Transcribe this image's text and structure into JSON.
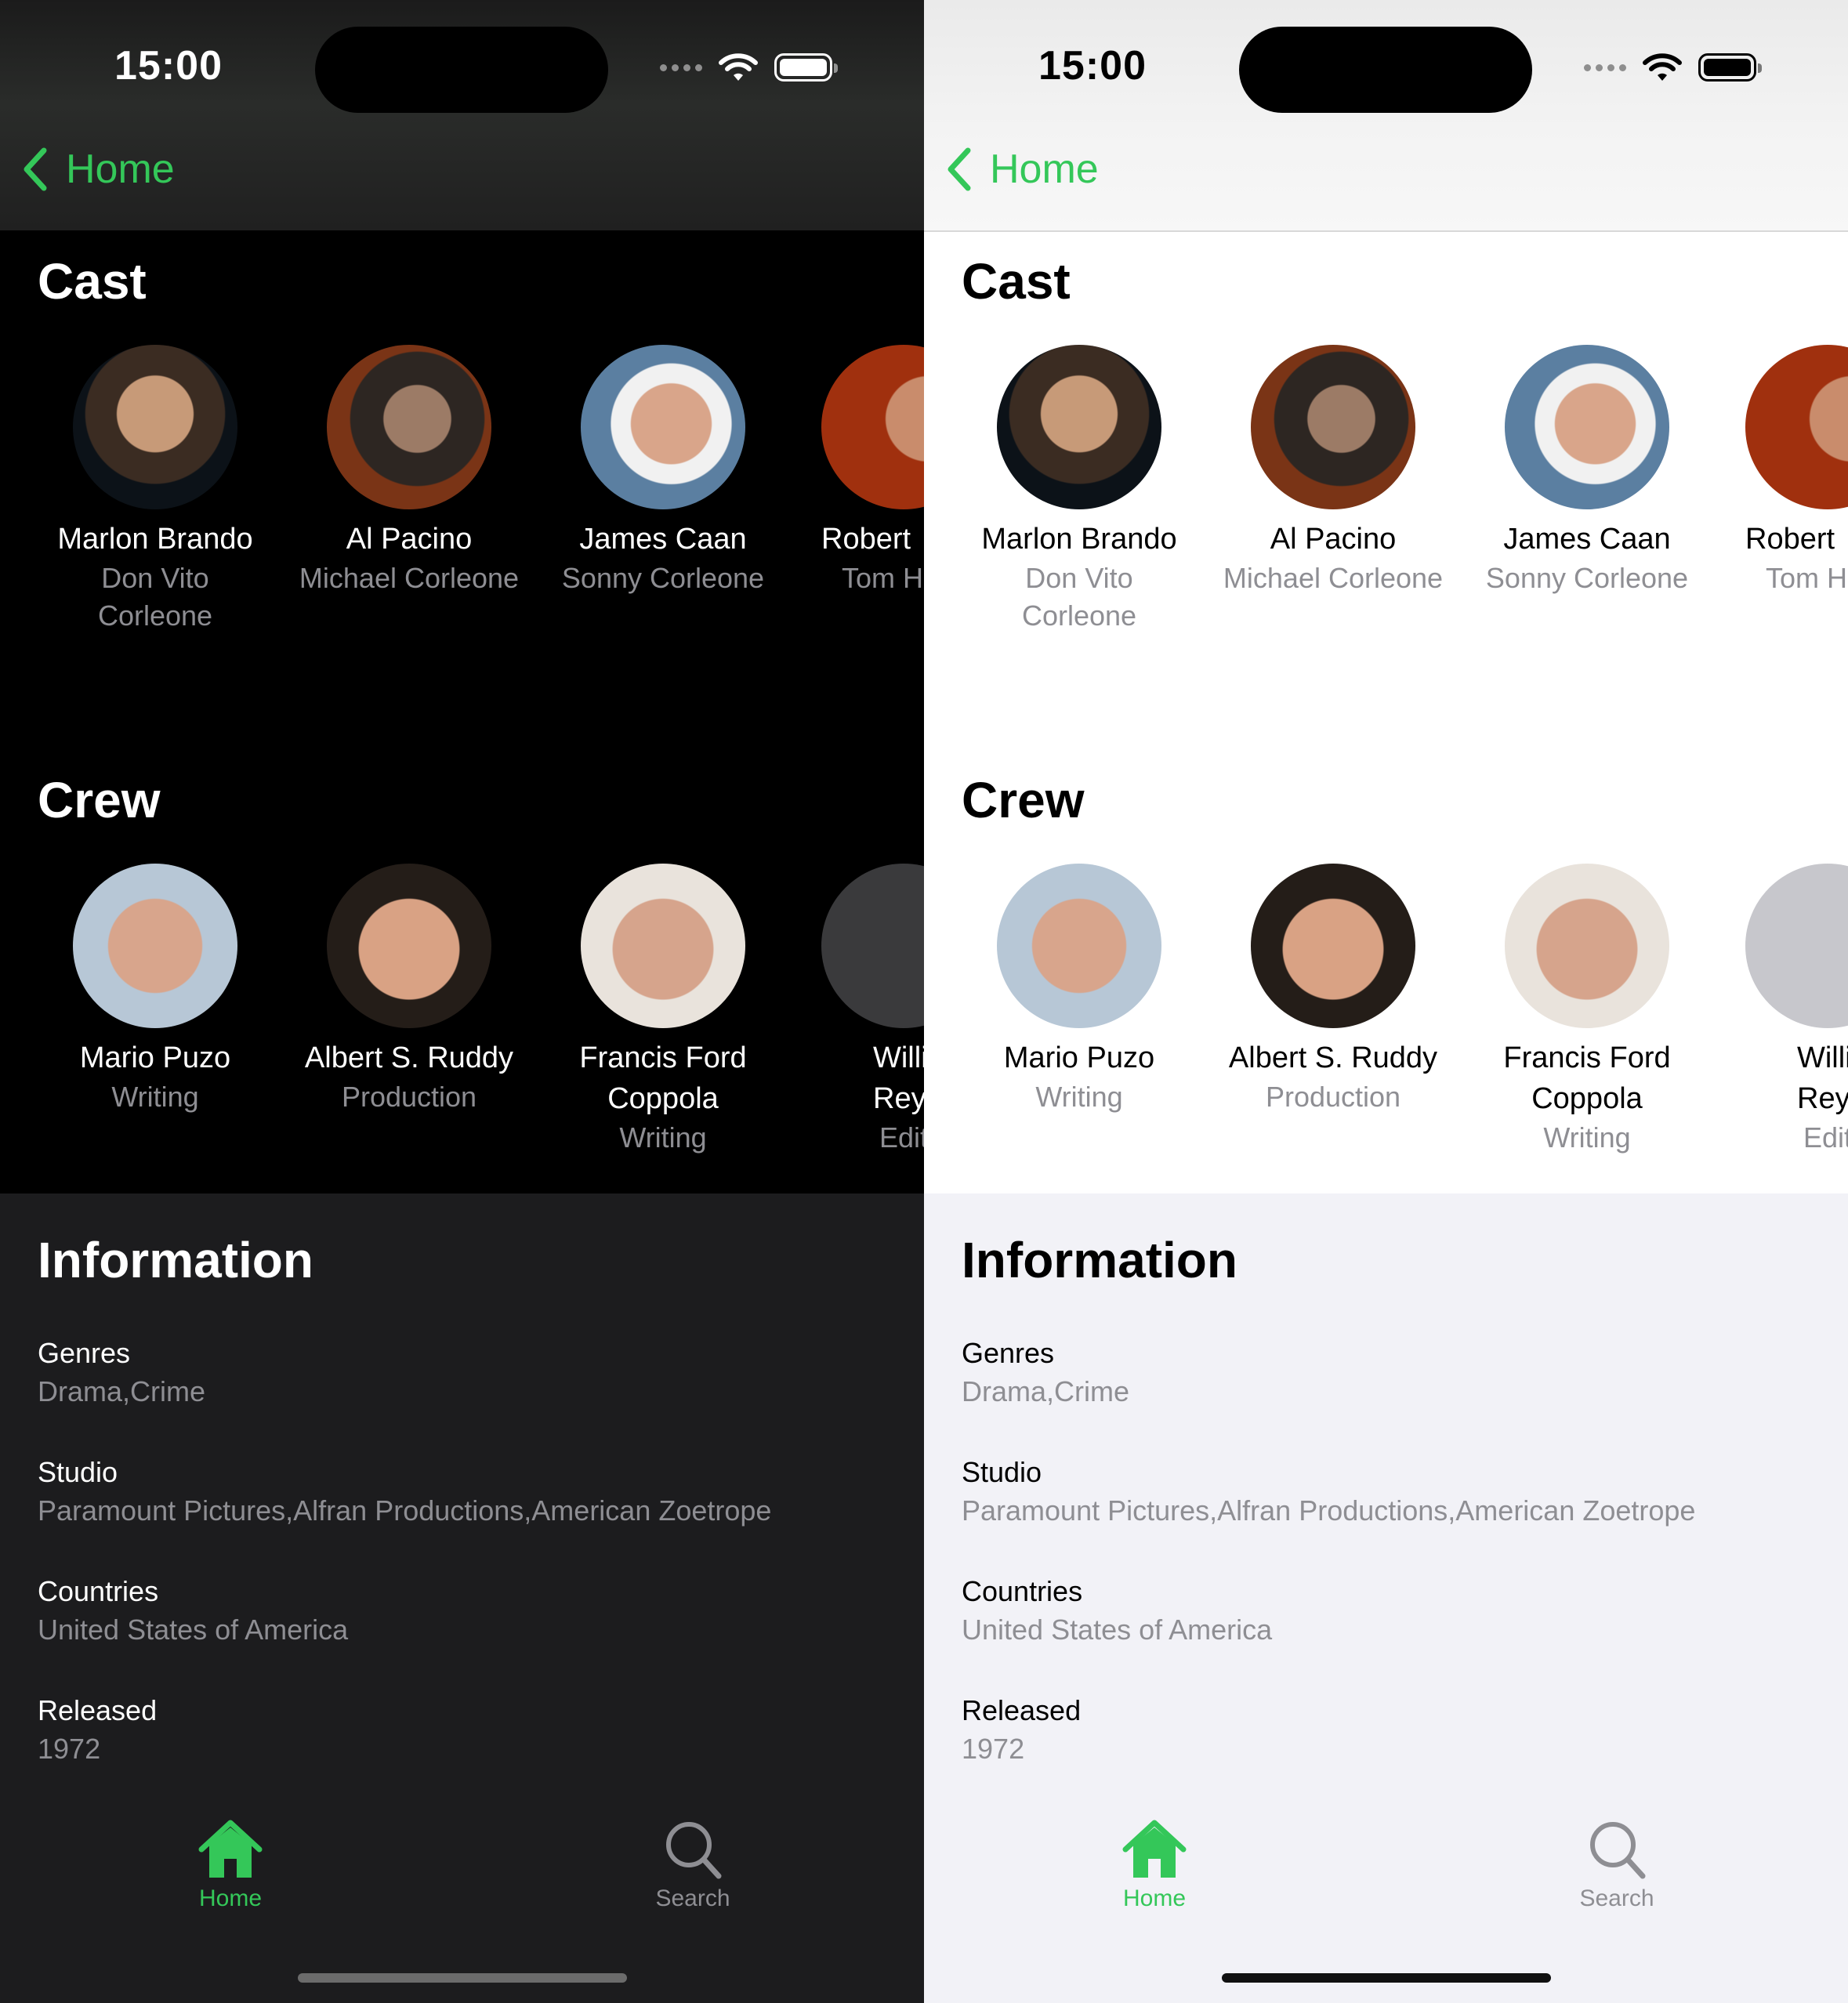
{
  "status": {
    "time": "15:00"
  },
  "nav": {
    "back_label": "Home"
  },
  "cast": {
    "title": "Cast",
    "items": [
      {
        "name": "Marlon Brando",
        "role": "Don Vito Corleone"
      },
      {
        "name": "Al Pacino",
        "role": "Michael Corleone"
      },
      {
        "name": "James Caan",
        "role": "Sonny Corleone"
      },
      {
        "name": "Robert",
        "role": "Tom H"
      }
    ]
  },
  "crew": {
    "title": "Crew",
    "items": [
      {
        "name": "Mario Puzo",
        "role": "Writing"
      },
      {
        "name": "Albert S. Ruddy",
        "role": "Production"
      },
      {
        "name": "Francis Ford Coppola",
        "role": "Writing"
      },
      {
        "name": "Willi Reyn",
        "role": "Edit"
      }
    ]
  },
  "info": {
    "title": "Information",
    "fields": [
      {
        "label": "Genres",
        "value": "Drama,Crime"
      },
      {
        "label": "Studio",
        "value": "Paramount Pictures,Alfran Productions,American Zoetrope"
      },
      {
        "label": "Countries",
        "value": "United States of America"
      },
      {
        "label": "Released",
        "value": "1972"
      }
    ]
  },
  "tabs": {
    "home": "Home",
    "search": "Search"
  },
  "colors": {
    "accent": "#34c759",
    "secondary": "#8e8e93"
  }
}
